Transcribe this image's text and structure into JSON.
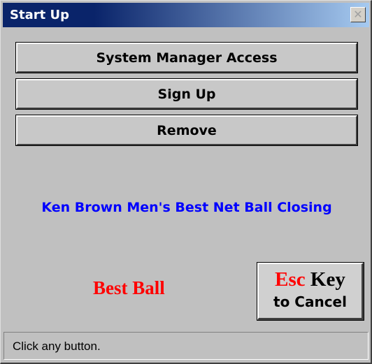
{
  "window": {
    "title": "Start Up",
    "close_symbol": "✕"
  },
  "buttons": {
    "system_manager": "System Manager Access",
    "sign_up": "Sign Up",
    "remove": "Remove"
  },
  "main": {
    "event_title": "Ken Brown Men's Best Net Ball Closing",
    "format_label": "Best Ball"
  },
  "escape": {
    "key_word": "Esc",
    "key_label": "Key",
    "cancel_text": "to Cancel"
  },
  "status": {
    "message": "Click any button."
  },
  "colors": {
    "title_gradient_start": "#0a246a",
    "title_gradient_end": "#a6caf0",
    "event_title": "#0000ff",
    "format_label": "#ff0000",
    "background": "#c0c0c0"
  },
  "icons": {
    "close": "close-icon"
  }
}
